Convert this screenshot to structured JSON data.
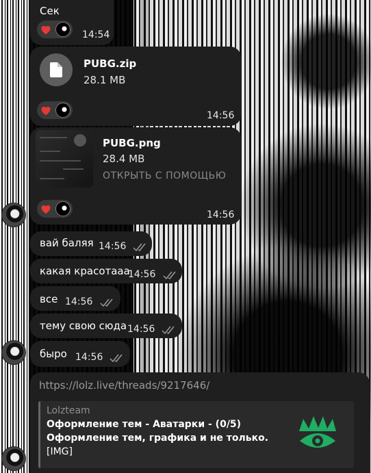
{
  "messages": [
    {
      "text": "Сек",
      "time": "14:54"
    },
    {
      "file_name": "PUBG.zip",
      "file_size": "28.1 MB",
      "time": "14:56"
    },
    {
      "file_name": "PUBG.png",
      "file_size": "28.4 MB",
      "action": "ОТКРЫТЬ С ПОМОЩЬЮ",
      "time": "14:56"
    },
    {
      "text": "вай баляя",
      "time": "14:56"
    },
    {
      "text": "какая красотааа",
      "time": "14:56"
    },
    {
      "text": "все",
      "time": "14:56"
    },
    {
      "text": "тему свою сюда",
      "time": "14:56"
    },
    {
      "text": "быро",
      "time": "14:56"
    },
    {
      "link": "https://lolz.live/threads/9217646/",
      "preview": {
        "site": "Lolzteam",
        "title": "Оформление тем - Аватарки - (0/5)",
        "description": "Оформление тем, графика и не только.",
        "extra": "[IMG]"
      }
    }
  ],
  "icons": {
    "reaction": "heart-icon",
    "file": "document-icon",
    "read": "double-check-icon",
    "logo": "eye-crown-logo"
  },
  "colors": {
    "bubble": "#1f1f1f",
    "heart": "#e53935",
    "logo_green": "#1fae63"
  }
}
